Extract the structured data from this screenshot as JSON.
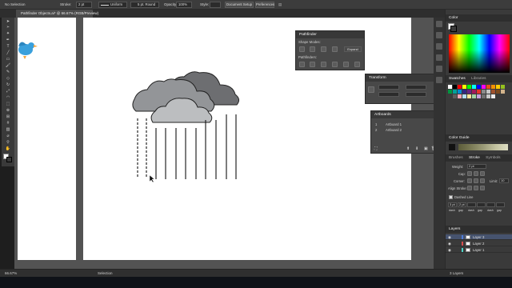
{
  "control_bar": {
    "selection": "No Selection",
    "stroke_label": "Stroke:",
    "stroke_value": "2 pt",
    "profile_value": "Uniform",
    "brush_value": "5 pt. Round",
    "opacity_label": "Opacity:",
    "opacity_value": "100%",
    "style_label": "Style:",
    "document_setup": "Document Setup",
    "preferences": "Preferences"
  },
  "document_tab": "Pathfinder Objects.ai* @ 66.67% (RGB/Preview)",
  "status_bar": {
    "zoom": "66.67%",
    "tool": "Selection",
    "layers_count": "3 Layers"
  },
  "pathfinder": {
    "title": "Pathfinder",
    "shape_modes": "Shape Modes:",
    "expand": "Expand",
    "pathfinders": "Pathfinders:"
  },
  "transform": {
    "title": "Transform"
  },
  "artboards": {
    "title": "Artboards",
    "rows": [
      {
        "num": "1",
        "name": "Artboard 1"
      },
      {
        "num": "2",
        "name": "Artboard 2"
      }
    ]
  },
  "color": {
    "title": "Color"
  },
  "swatches": {
    "tab_swatches": "Swatches",
    "tab_libraries": "Libraries"
  },
  "color_guide": {
    "title": "Color Guide"
  },
  "stroke_panel": {
    "tab_brushes": "Brushes",
    "tab_stroke": "Stroke",
    "tab_symbols": "Symbols",
    "weight_label": "Weight:",
    "weight_value": "2 pt",
    "cap_label": "Cap:",
    "corner_label": "Corner:",
    "limit_label": "Limit:",
    "limit_value": "10",
    "align_label": "Align Stroke:",
    "dashed_label": "Dashed Line",
    "dash_values": [
      "3 pt",
      "2 pt",
      "",
      "",
      "",
      ""
    ],
    "dash_labels": [
      "dash",
      "gap",
      "dash",
      "gap",
      "dash",
      "gap"
    ]
  },
  "layers": {
    "title": "Layers",
    "rows": [
      {
        "name": "Layer 3",
        "color": "#4f7bd6"
      },
      {
        "name": "Layer 2",
        "color": "#d64f4f"
      },
      {
        "name": "Layer 1",
        "color": "#4fd6c8"
      }
    ]
  },
  "artwork": {
    "cloud_back_color": "#6d6e71",
    "cloud_mid_color": "#939598",
    "cloud_front_color": "#bcbec0",
    "rain_color": "#111111"
  }
}
